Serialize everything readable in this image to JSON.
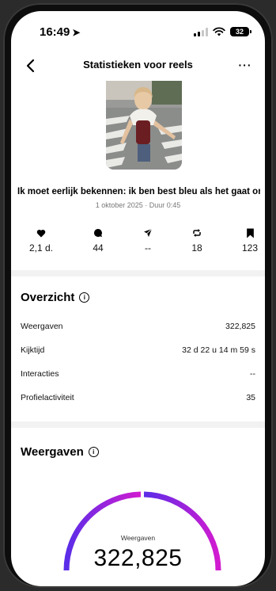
{
  "status_bar": {
    "time": "16:49",
    "battery": "32"
  },
  "header": {
    "title": "Statistieken voor reels",
    "more": "···"
  },
  "reel": {
    "caption": "Ik moet eerlijk bekennen: ik ben best bleu als het gaat om...",
    "meta": "1 oktober 2025 · Duur 0:45"
  },
  "stats": [
    {
      "icon": "heart-icon",
      "value": "2,1 d."
    },
    {
      "icon": "comment-icon",
      "value": "44"
    },
    {
      "icon": "share-icon",
      "value": "--"
    },
    {
      "icon": "repost-icon",
      "value": "18"
    },
    {
      "icon": "bookmark-icon",
      "value": "123"
    }
  ],
  "overview": {
    "title": "Overzicht",
    "rows": [
      {
        "label": "Weergaven",
        "value": "322,825"
      },
      {
        "label": "Kijktijd",
        "value": "32 d 22 u 14 m 59 s"
      },
      {
        "label": "Interacties",
        "value": "--"
      },
      {
        "label": "Profielactiviteit",
        "value": "35"
      }
    ]
  },
  "views": {
    "title": "Weergaven",
    "gauge_label": "Weergaven",
    "gauge_value": "322,825",
    "colors": {
      "start": "#5a2de8",
      "end": "#d21bd0"
    }
  }
}
